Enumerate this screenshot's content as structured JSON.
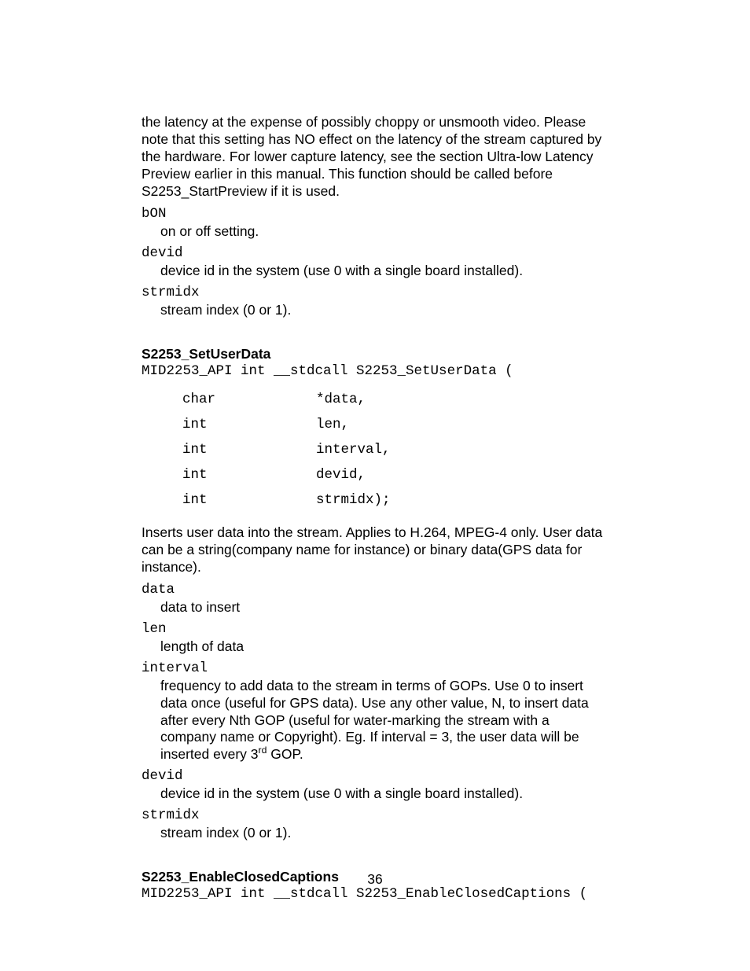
{
  "intro": "the latency at the expense of possibly choppy or unsmooth video.  Please note that this setting has NO effect on the latency of the stream captured by the hardware.  For lower capture latency, see the section Ultra-low Latency Preview earlier in this manual.  This function should be called before S2253_StartPreview if it is used.",
  "params_top": [
    {
      "name": "bON",
      "desc": "on or off setting."
    },
    {
      "name": "devid",
      "desc": "device id in the system (use 0 with a single board installed)."
    },
    {
      "name": "strmidx",
      "desc": "stream index (0 or 1)."
    }
  ],
  "func1": {
    "title": "S2253_SetUserData",
    "sig_head": "MID2253_API int __stdcall S2253_SetUserData (",
    "args": [
      [
        "char",
        "*data,"
      ],
      [
        "int",
        "len,"
      ],
      [
        "int",
        "interval,"
      ],
      [
        "int",
        "devid,"
      ],
      [
        "int",
        "strmidx);"
      ]
    ],
    "desc": "Inserts user data into the stream.  Applies to H.264, MPEG-4 only.  User data can be a string(company name for instance) or binary data(GPS data for instance).",
    "params": [
      {
        "name": "data",
        "desc": "data to insert"
      },
      {
        "name": "len",
        "desc": "length of data"
      },
      {
        "name": "interval",
        "desc_pre": "frequency to add data to the stream in terms of GOPs.  Use 0 to insert data once (useful for GPS data).  Use any other value, N, to insert data after every Nth GOP (useful for water-marking the stream with a company name or Copyright).  Eg. If interval = 3, the user data will be inserted every 3",
        "sup": "rd",
        "desc_post": " GOP."
      },
      {
        "name": "devid",
        "desc": "device id in the system (use 0 with a single board installed)."
      },
      {
        "name": "strmidx",
        "desc": "stream index (0 or 1)."
      }
    ]
  },
  "func2": {
    "title": "S2253_EnableClosedCaptions",
    "sig_head": "MID2253_API int __stdcall S2253_EnableClosedCaptions ("
  },
  "page_number": "36"
}
